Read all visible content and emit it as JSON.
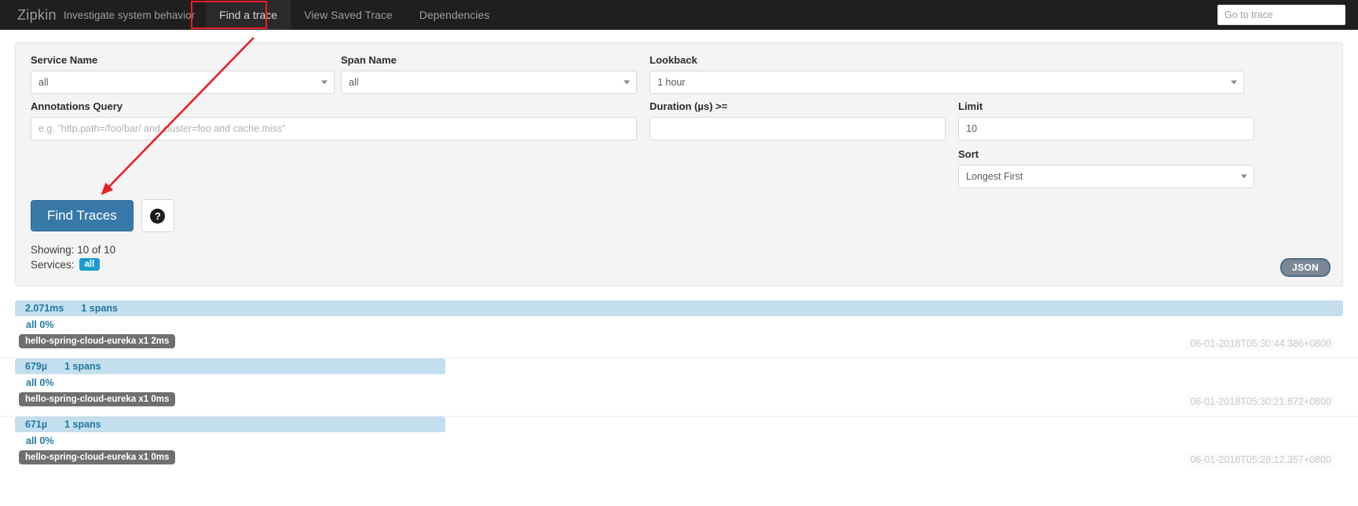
{
  "navbar": {
    "brand": "Zipkin",
    "tagline": "Investigate system behavior",
    "links": [
      {
        "label": "Find a trace",
        "active": true
      },
      {
        "label": "View Saved Trace",
        "active": false
      },
      {
        "label": "Dependencies",
        "active": false
      }
    ],
    "go_to_trace_placeholder": "Go to trace",
    "go_to_trace_value": "",
    "highlight_color": "#ee1c25"
  },
  "search": {
    "service_name": {
      "label": "Service Name",
      "value": "all"
    },
    "span_name": {
      "label": "Span Name",
      "value": "all"
    },
    "lookback": {
      "label": "Lookback",
      "value": "1 hour"
    },
    "annotations_query": {
      "label": "Annotations Query",
      "value": "",
      "placeholder": "e.g. \"http.path=/foo/bar/ and cluster=foo and cache.miss\""
    },
    "duration": {
      "label": "Duration (µs) >=",
      "value": ""
    },
    "limit": {
      "label": "Limit",
      "value": "10"
    },
    "sort": {
      "label": "Sort",
      "value": "Longest First"
    },
    "find_button": "Find Traces",
    "help_icon": "question-circle-icon",
    "showing": "Showing: 10 of 10",
    "services_label": "Services:",
    "services_badge": "all",
    "json_badge": "JSON",
    "accent_color": "#3879aa",
    "badge_color": "#1b9ccc"
  },
  "results": [
    {
      "duration": "2.071ms",
      "spans": "1 spans",
      "percent": "all 0%",
      "service_pill": "hello-spring-cloud-eureka x1 2ms",
      "timestamp": "06-01-2018T05:30:44.386+0800",
      "bar_width_pct": 100
    },
    {
      "duration": "679µ",
      "spans": "1 spans",
      "percent": "all 0%",
      "service_pill": "hello-spring-cloud-eureka x1 0ms",
      "timestamp": "06-01-2018T05:30:21.872+0800",
      "bar_width_pct": 32.4
    },
    {
      "duration": "671µ",
      "spans": "1 spans",
      "percent": "all 0%",
      "service_pill": "hello-spring-cloud-eureka x1 0ms",
      "timestamp": "06-01-2018T05:28:12.357+0800",
      "bar_width_pct": 32.4
    }
  ]
}
